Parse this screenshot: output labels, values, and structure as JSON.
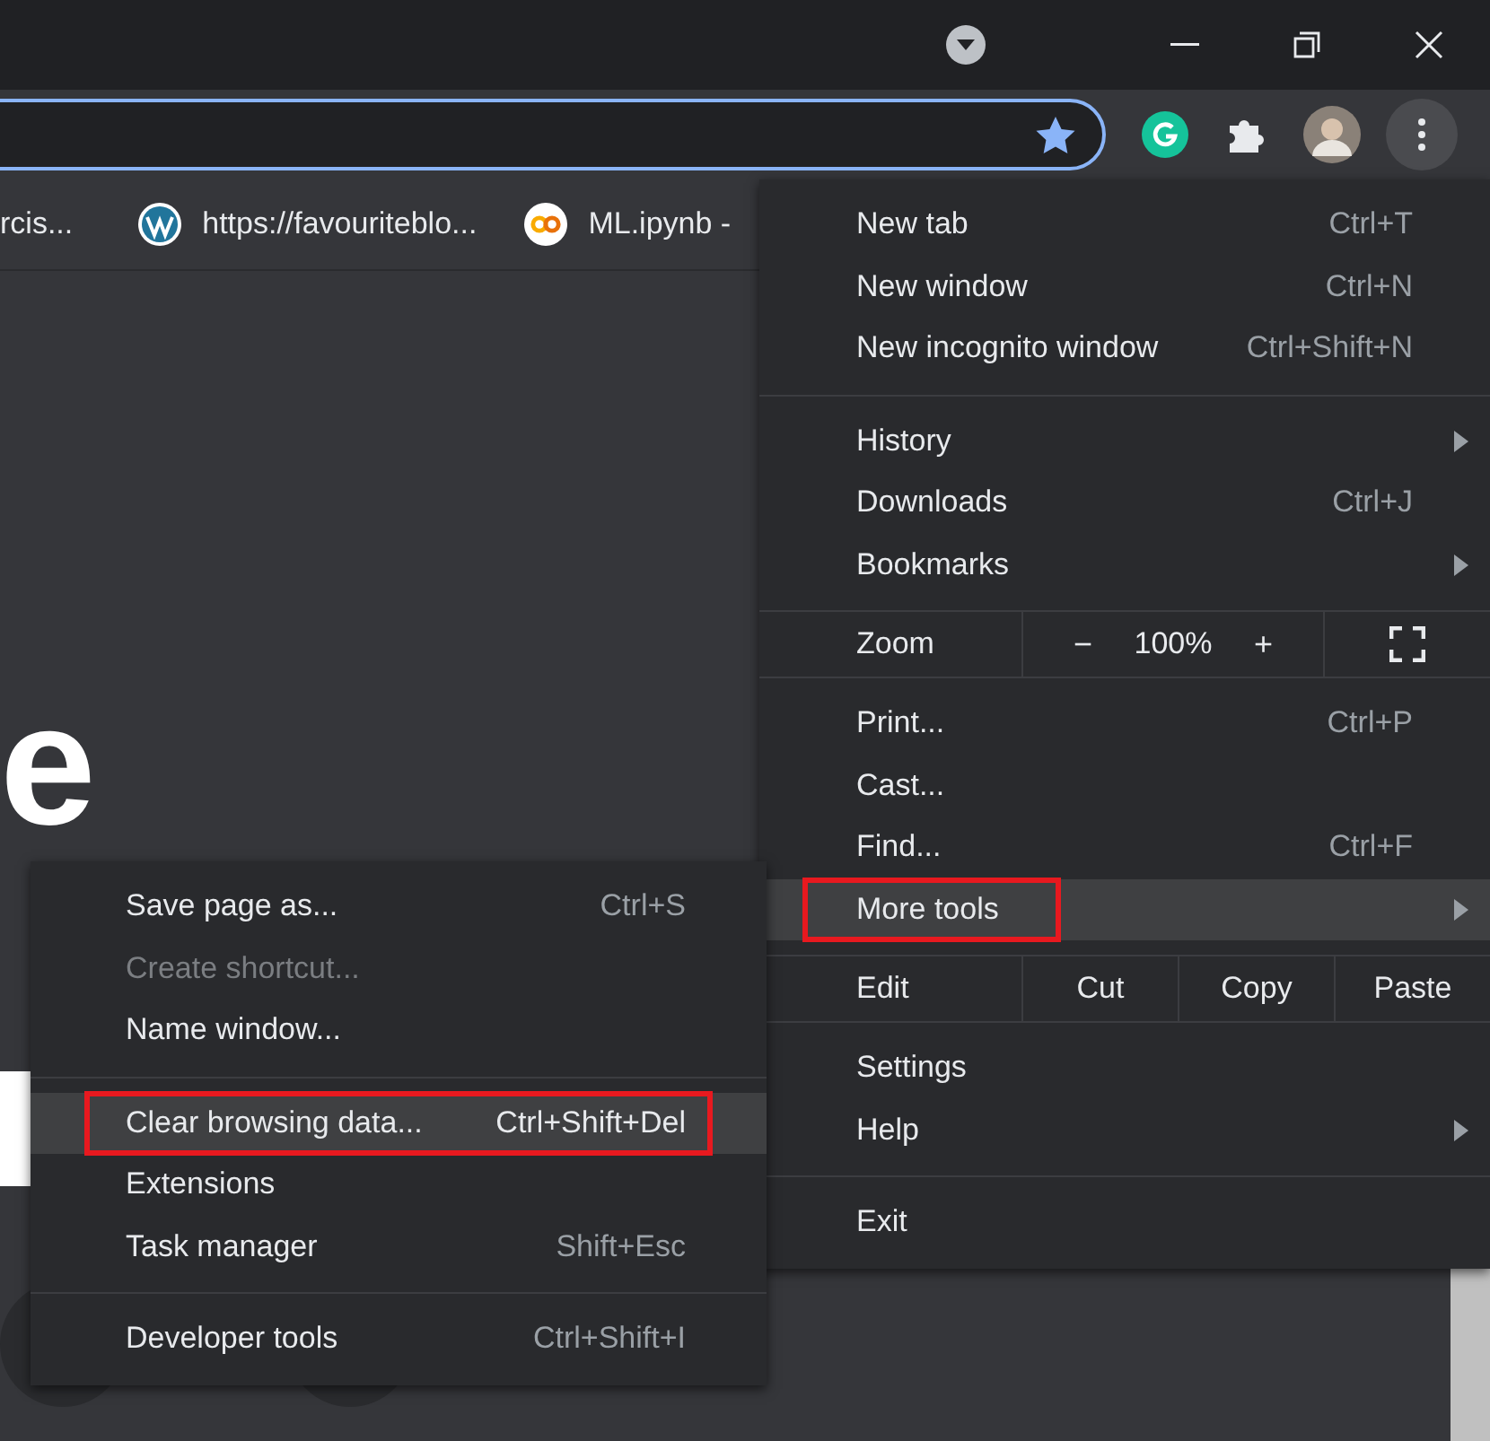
{
  "toolbar": {
    "address_focused": true,
    "menu_button_active": true
  },
  "bookmarks": [
    {
      "kind": "plain",
      "label": "rcis..."
    },
    {
      "kind": "wordpress",
      "label": "https://favouriteblo..."
    },
    {
      "kind": "colab",
      "label": "ML.ipynb -"
    }
  ],
  "page": {
    "heading_fragment": "e"
  },
  "menu": {
    "groups": [
      {
        "items": [
          {
            "kind": "item",
            "label": "New tab",
            "shortcut": "Ctrl+T",
            "submenu": false,
            "selected": false,
            "annotated": false
          },
          {
            "kind": "item",
            "label": "New window",
            "shortcut": "Ctrl+N",
            "submenu": false,
            "selected": false,
            "annotated": false
          },
          {
            "kind": "item",
            "label": "New incognito window",
            "shortcut": "Ctrl+Shift+N",
            "submenu": false,
            "selected": false,
            "annotated": false
          }
        ]
      },
      {
        "items": [
          {
            "kind": "item",
            "label": "History",
            "submenu": true,
            "selected": false,
            "annotated": false
          },
          {
            "kind": "item",
            "label": "Downloads",
            "shortcut": "Ctrl+J",
            "submenu": false,
            "selected": false,
            "annotated": false
          },
          {
            "kind": "item",
            "label": "Bookmarks",
            "submenu": true,
            "selected": false,
            "annotated": false
          }
        ]
      },
      {
        "items": [
          {
            "kind": "zoom",
            "label": "Zoom",
            "minus": "−",
            "value": "100%",
            "plus": "+"
          }
        ]
      },
      {
        "items": [
          {
            "kind": "item",
            "label": "Print...",
            "shortcut": "Ctrl+P",
            "submenu": false,
            "selected": false,
            "annotated": false
          },
          {
            "kind": "item",
            "label": "Cast...",
            "submenu": false,
            "selected": false,
            "annotated": false
          },
          {
            "kind": "item",
            "label": "Find...",
            "shortcut": "Ctrl+F",
            "submenu": false,
            "selected": false,
            "annotated": false
          },
          {
            "kind": "item",
            "label": "More tools",
            "submenu": true,
            "selected": true,
            "annotated": true
          }
        ]
      },
      {
        "items": [
          {
            "kind": "edit",
            "label": "Edit",
            "actions": [
              "Cut",
              "Copy",
              "Paste"
            ]
          }
        ]
      },
      {
        "items": [
          {
            "kind": "item",
            "label": "Settings",
            "submenu": false,
            "selected": false,
            "annotated": false
          },
          {
            "kind": "item",
            "label": "Help",
            "submenu": true,
            "selected": false,
            "annotated": false
          }
        ]
      },
      {
        "items": [
          {
            "kind": "item",
            "label": "Exit",
            "submenu": false,
            "selected": false,
            "annotated": false
          }
        ]
      }
    ]
  },
  "submenu": {
    "groups": [
      {
        "items": [
          {
            "label": "Save page as...",
            "shortcut": "Ctrl+S",
            "disabled": false,
            "selected": false,
            "annotated": false
          },
          {
            "label": "Create shortcut...",
            "disabled": true,
            "selected": false,
            "annotated": false
          },
          {
            "label": "Name window...",
            "disabled": false,
            "selected": false,
            "annotated": false
          }
        ]
      },
      {
        "items": [
          {
            "label": "Clear browsing data...",
            "shortcut": "Ctrl+Shift+Del",
            "disabled": false,
            "selected": true,
            "annotated": true
          },
          {
            "label": "Extensions",
            "disabled": false,
            "selected": false,
            "annotated": false
          },
          {
            "label": "Task manager",
            "shortcut": "Shift+Esc",
            "disabled": false,
            "selected": false,
            "annotated": false
          }
        ]
      },
      {
        "items": [
          {
            "label": "Developer tools",
            "shortcut": "Ctrl+Shift+I",
            "disabled": false,
            "selected": false,
            "annotated": false
          }
        ]
      }
    ]
  }
}
